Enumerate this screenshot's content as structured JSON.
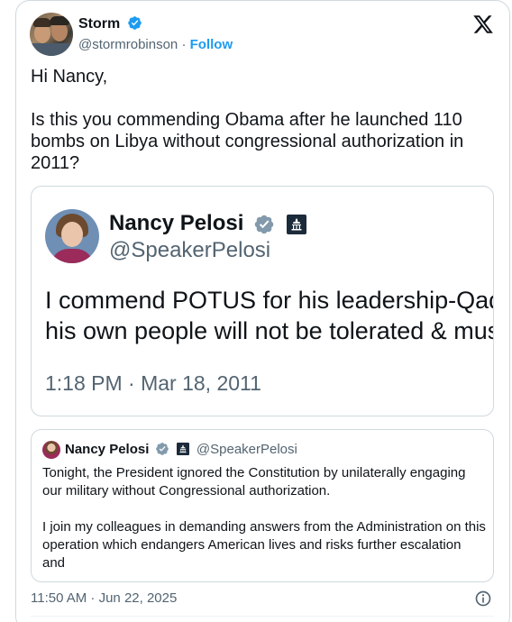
{
  "author": {
    "name": "Storm",
    "handle": "@stormrobinson",
    "separator": "·",
    "follow_label": "Follow"
  },
  "tweet": {
    "text": "Hi Nancy,\n\nIs this you commending Obama after he launched 110 bombs on Libya without congressional authorization in 2011?"
  },
  "embedded_screenshot": {
    "name": "Nancy Pelosi",
    "handle": "@SpeakerPelosi",
    "text": "I commend POTUS for his leadership-Qaddafi\nhis own people will not be tolerated & must st",
    "timestamp": "1:18 PM · Mar 18, 2011"
  },
  "quoted_tweet": {
    "name": "Nancy Pelosi",
    "handle": "@SpeakerPelosi",
    "text": "Tonight, the President ignored the Constitution by unilaterally engaging our military without Congressional authorization.\n\nI join my colleagues in demanding answers from the Administration on this operation which endangers American lives and risks further escalation and"
  },
  "timestamp": "11:50 AM · Jun 22, 2025",
  "colors": {
    "accent": "#1d9bf0",
    "verified_gray": "#829aab",
    "text_secondary": "#536471",
    "border": "#cfd9de"
  },
  "icons": {
    "verified": "verified-badge-icon",
    "government": "capitol-icon",
    "platform": "x-logo-icon",
    "info": "info-icon"
  }
}
